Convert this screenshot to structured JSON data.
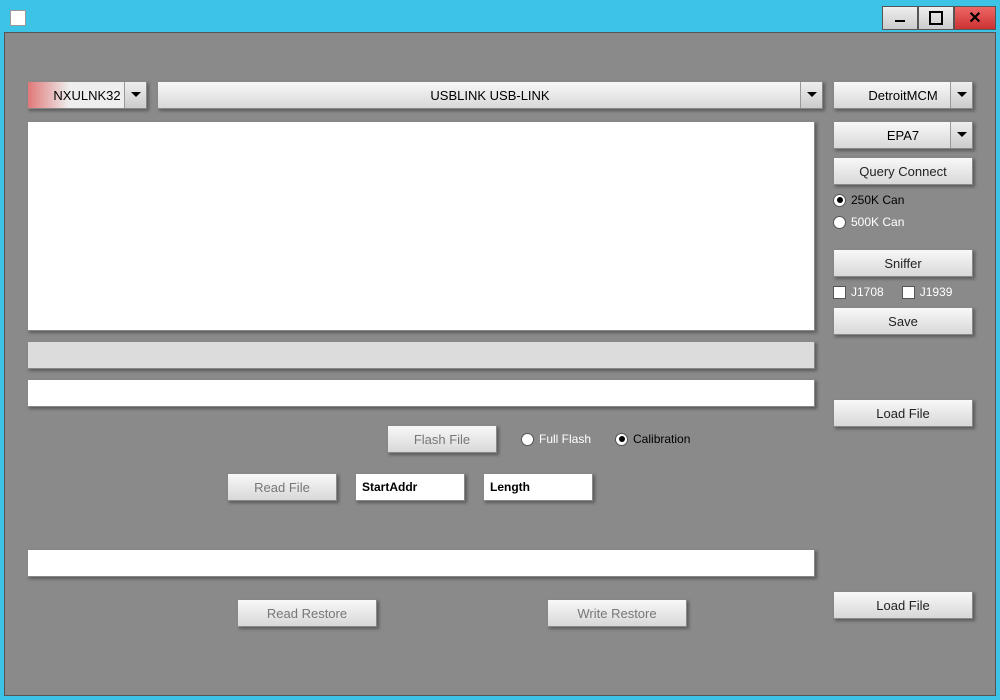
{
  "title": "",
  "window_buttons": {
    "min": "–",
    "max": "▢",
    "close": "✕"
  },
  "dropdowns": {
    "adapter": "NXULNK32",
    "device": "USBLINK USB-LINK",
    "module": "DetroitMCM",
    "epa": "EPA7"
  },
  "buttons": {
    "query_connect": "Query Connect",
    "sniffer": "Sniffer",
    "save": "Save",
    "load_file_1": "Load File",
    "load_file_2": "Load File",
    "flash_file": "Flash File",
    "read_file": "Read File",
    "read_restore": "Read Restore",
    "write_restore": "Write Restore"
  },
  "radios": {
    "can250": "250K Can",
    "can500": "500K Can",
    "full_flash": "Full Flash",
    "calibration": "Calibration"
  },
  "checks": {
    "j1708": "J1708",
    "j1939": "J1939"
  },
  "inputs": {
    "start_addr_placeholder": "StartAddr",
    "length_placeholder": "Length"
  }
}
